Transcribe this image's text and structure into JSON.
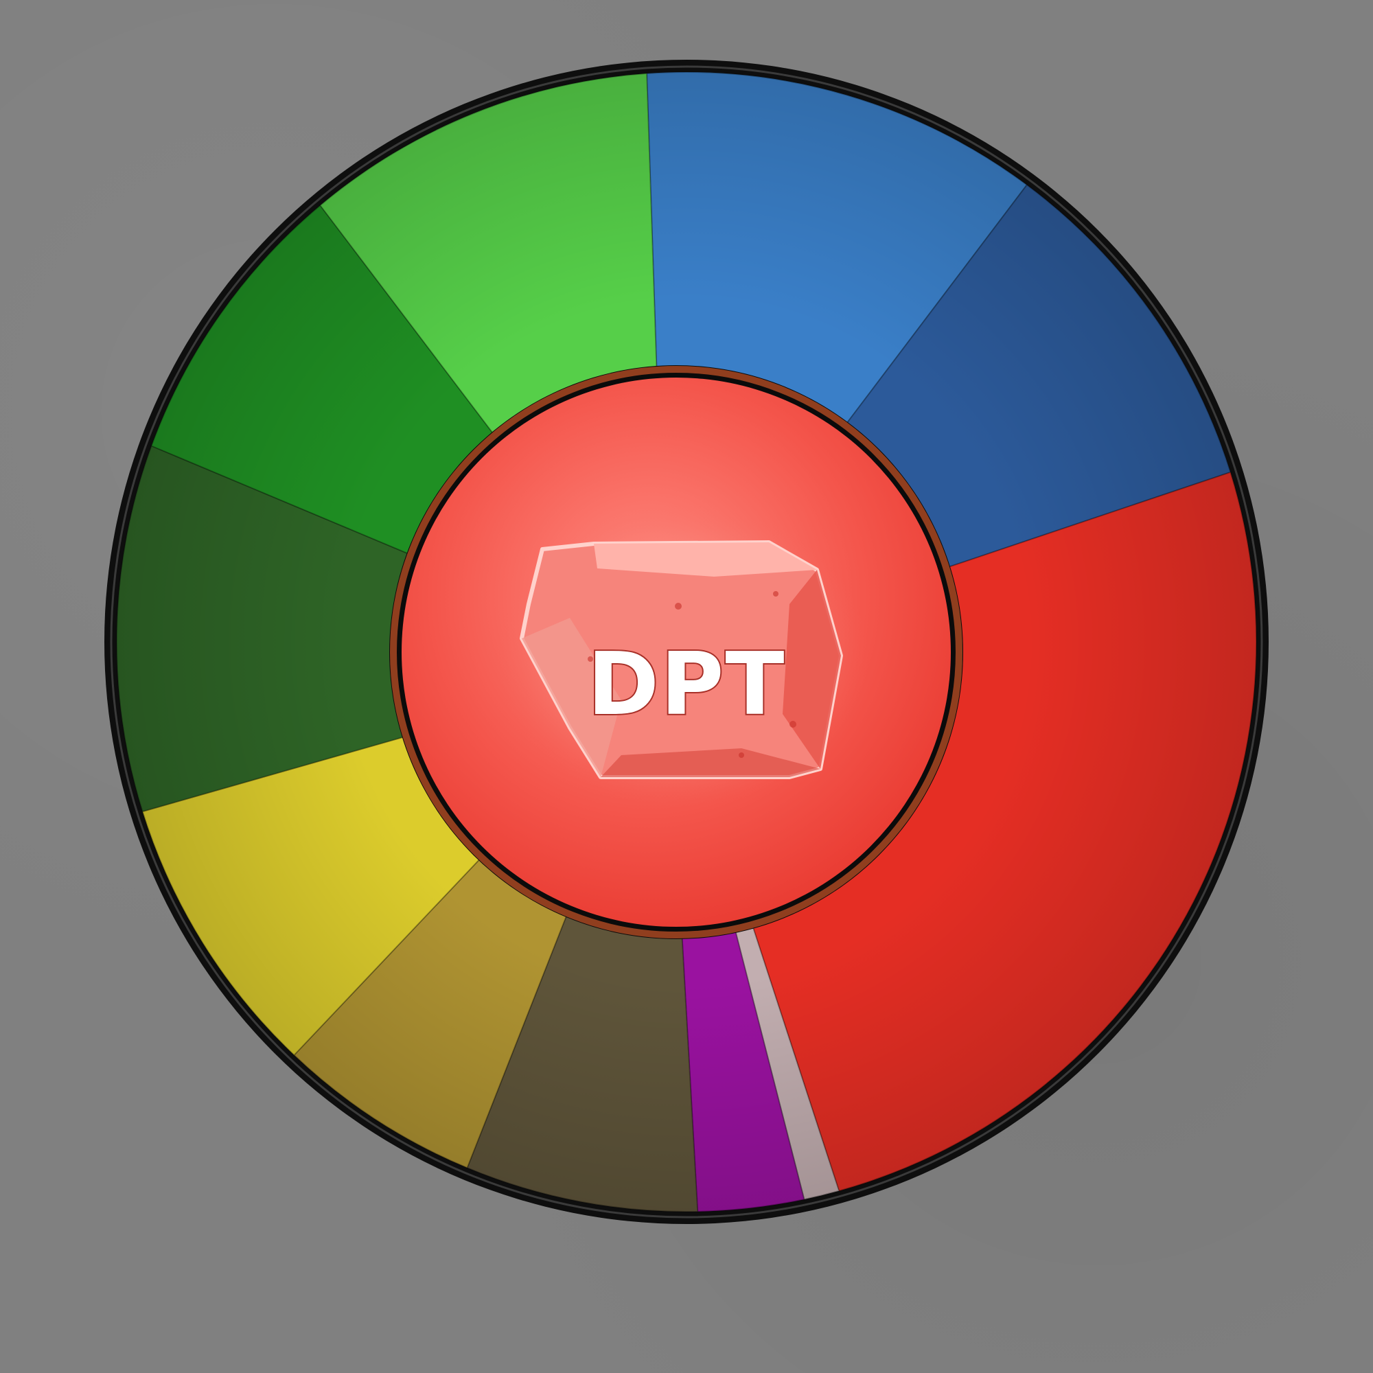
{
  "wheel": {
    "segments": [
      {
        "id": "blue-light",
        "color": "#3a7fc8",
        "share": 0.113
      },
      {
        "id": "blue-dark",
        "color": "#2c5a9a",
        "share": 0.1
      },
      {
        "id": "red-large",
        "color": "#e52e24",
        "share": 0.255
      },
      {
        "id": "gray-divider",
        "color": "#c2aeb0",
        "share": 0.01
      },
      {
        "id": "purple",
        "color": "#9a12a0",
        "share": 0.03
      },
      {
        "id": "brown-dark",
        "color": "#5f553a",
        "share": 0.066
      },
      {
        "id": "olive",
        "color": "#b09432",
        "share": 0.058
      },
      {
        "id": "yellow",
        "color": "#dccc2c",
        "share": 0.081
      },
      {
        "id": "green-darkest",
        "color": "#2e6426",
        "share": 0.104
      },
      {
        "id": "green-dark",
        "color": "#1f8f23",
        "share": 0.083
      },
      {
        "id": "green-light",
        "color": "#56cf49",
        "share": 0.1
      }
    ],
    "hub_color": "#f44a42",
    "rim_color": "#0e0e0e"
  },
  "gem": {
    "label": "DPT",
    "color": "#f06a60",
    "icon": "ruby-gem-icon"
  }
}
